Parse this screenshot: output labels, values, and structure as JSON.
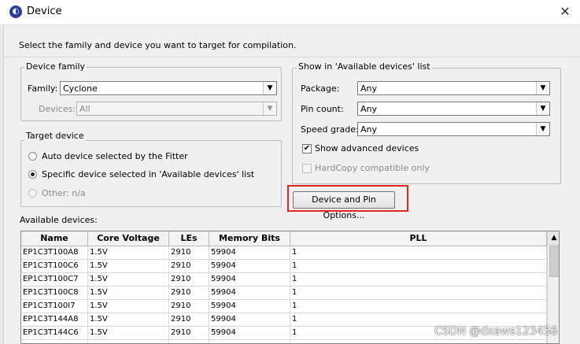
{
  "window": {
    "title": "Device"
  },
  "prompt": "Select the family and device you want to target for compilation.",
  "device_family": {
    "group_label": "Device family",
    "family_label": "Family:",
    "family_value": "Cyclone",
    "devices_label": "Devices:",
    "devices_value": "All"
  },
  "target_device": {
    "group_label": "Target device",
    "options": [
      {
        "label": "Auto device selected by the Fitter",
        "selected": false,
        "enabled": true
      },
      {
        "label": "Specific device selected in 'Available devices' list",
        "selected": true,
        "enabled": true
      },
      {
        "label": "Other:  n/a",
        "selected": false,
        "enabled": false
      }
    ]
  },
  "show_list": {
    "group_label": "Show in 'Available devices' list",
    "package_label": "Package:",
    "package_value": "Any",
    "pin_count_label": "Pin count:",
    "pin_count_value": "Any",
    "speed_grade_label": "Speed grade:",
    "speed_grade_value": "Any",
    "show_advanced_label": "Show advanced devices",
    "show_advanced_checked": true,
    "hardcopy_label": "HardCopy compatible only",
    "hardcopy_checked": false
  },
  "device_pin_options_button": "Device and Pin Options...",
  "available_devices": {
    "label": "Available devices:",
    "columns": [
      "Name",
      "Core Voltage",
      "LEs",
      "Memory Bits",
      "PLL"
    ],
    "rows": [
      [
        "EP1C3T100A8",
        "1.5V",
        "2910",
        "59904",
        "1"
      ],
      [
        "EP1C3T100C6",
        "1.5V",
        "2910",
        "59904",
        "1"
      ],
      [
        "EP1C3T100C7",
        "1.5V",
        "2910",
        "59904",
        "1"
      ],
      [
        "EP1C3T100C8",
        "1.5V",
        "2910",
        "59904",
        "1"
      ],
      [
        "EP1C3T100I7",
        "1.5V",
        "2910",
        "59904",
        "1"
      ],
      [
        "EP1C3T144A8",
        "1.5V",
        "2910",
        "59904",
        "1"
      ],
      [
        "EP1C3T144C6",
        "1.5V",
        "2910",
        "59904",
        "1"
      ],
      [
        "",
        "",
        "",
        "",
        ""
      ]
    ]
  },
  "watermark": "CSDN @dxaws123456",
  "colors": {
    "highlight_border": "#e0261e",
    "dialog_bg": "#f0f0f0"
  }
}
